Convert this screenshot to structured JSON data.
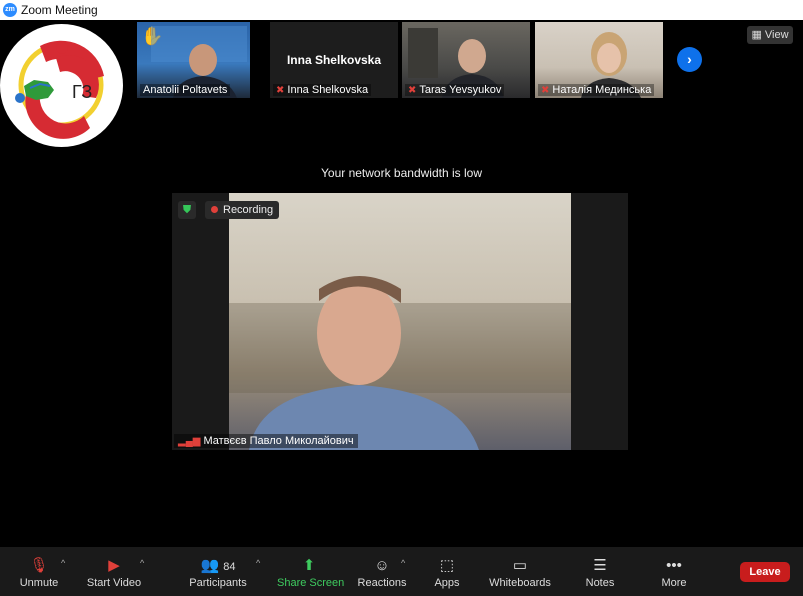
{
  "window": {
    "title": "Zoom Meeting",
    "app_icon": "zm"
  },
  "thumbnails": [
    {
      "name": "Anatolii Poltavets",
      "muted": false,
      "reaction": "✋"
    },
    {
      "name": "Inna Shelkovska",
      "muted": true,
      "center_name": "Inna Shelkovska"
    },
    {
      "name": "Taras Yevsyukov",
      "muted": true
    },
    {
      "name": "Наталія Мединська",
      "muted": true
    }
  ],
  "view_label": "View",
  "next_page_icon": "›",
  "notice": "Your network bandwidth is low",
  "main_video": {
    "recording_label": "Recording",
    "speaker_name": "Матвєєв Павло Миколайович"
  },
  "brand_logo_text": "ГЗ",
  "toolbar": {
    "unmute": "Unmute",
    "start_video": "Start Video",
    "participants": "Participants",
    "participants_count": "84",
    "share_screen": "Share Screen",
    "reactions": "Reactions",
    "apps": "Apps",
    "whiteboards": "Whiteboards",
    "notes": "Notes",
    "more": "More",
    "leave": "Leave"
  },
  "colors": {
    "accent": "#2D8CFF",
    "share": "#3ecb5f",
    "leave": "#c81d1d",
    "muted": "#e0403a"
  }
}
